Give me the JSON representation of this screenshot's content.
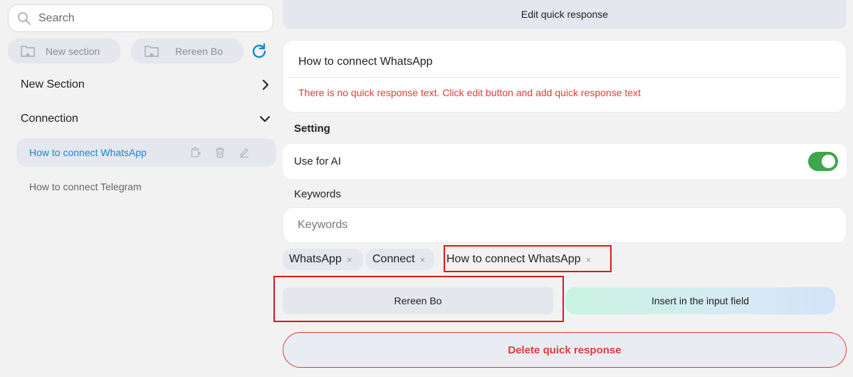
{
  "sidebar": {
    "search_placeholder": "Search",
    "buttons": {
      "new_section": "New section",
      "rereen": "Rereen Bo"
    },
    "sections": [
      {
        "label": "New Section",
        "expanded": false
      },
      {
        "label": "Connection",
        "expanded": true
      }
    ],
    "items": [
      {
        "label": "How to connect WhatsApp",
        "active": true
      },
      {
        "label": "How to connect Telegram",
        "active": false
      }
    ]
  },
  "editor": {
    "header_title": "Edit quick response",
    "response_title": "How to connect WhatsApp",
    "empty_warning": "There is no quick response text. Click edit button and add quick response text",
    "setting_label": "Setting",
    "use_for_ai_label": "Use for AI",
    "use_for_ai_enabled": true,
    "keywords_label": "Keywords",
    "keywords_placeholder": "Keywords",
    "tags": [
      "WhatsApp",
      "Connect",
      "How to connect WhatsApp"
    ],
    "tag_remove_glyph": "×",
    "rereen_button": "Rereen Bo",
    "insert_button": "Insert in the input field",
    "delete_button": "Delete quick response"
  },
  "colors": {
    "accent_blue": "#1b87c9",
    "toggle_green": "#3fa64b",
    "danger_red": "#e23b3b",
    "highlight_red": "#e01818"
  }
}
